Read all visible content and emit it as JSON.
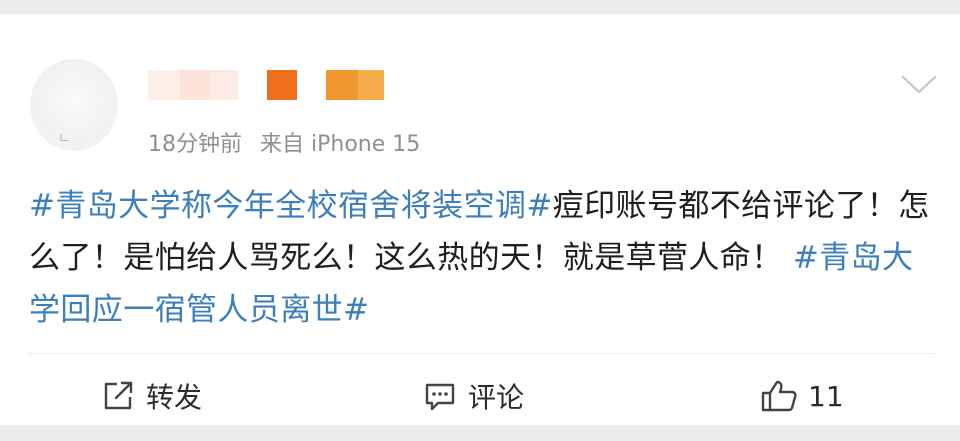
{
  "post": {
    "avatar_mark": "ㄴ",
    "meta": {
      "time": "18分钟前",
      "source": "来自 iPhone 15"
    },
    "text": {
      "topic1": "#青岛大学称今年全校宿舍将装空调#",
      "body": "痘印账号都不给评论了！怎么了！是怕给人骂死么！这么热的天！就是草菅人命！",
      "topic2": "#青岛大学回应一宿管人员离世#"
    }
  },
  "actions": {
    "repost_label": "转发",
    "comment_label": "评论",
    "like_count": "11"
  },
  "colors": {
    "topic": "#3d7fb8",
    "background": "#ececec",
    "card": "#ffffff",
    "meta": "#8f8f8f"
  },
  "icons": {
    "more": "chevron-down-icon",
    "repost": "share-icon",
    "comment": "comment-icon",
    "like": "thumbs-up-icon"
  }
}
